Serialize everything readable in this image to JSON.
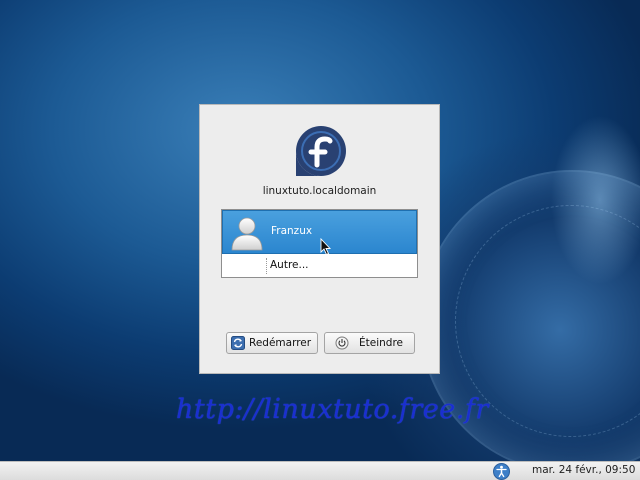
{
  "dialog": {
    "hostname": "linuxtuto.localdomain",
    "users": [
      {
        "name": "Franzux",
        "selected": true
      },
      {
        "name": "Autre...",
        "selected": false
      }
    ],
    "buttons": {
      "restart_label": "Redémarrer",
      "shutdown_label": "Éteindre"
    }
  },
  "watermark": {
    "text": "http://linuxtuto.free.fr"
  },
  "panel": {
    "clock": "mar. 24 févr., 09:50",
    "accessibility_icon": "accessibility-icon"
  },
  "colors": {
    "selection": "#2b86cf",
    "watermark": "#1a2fd0",
    "fedora_blue": "#294172"
  }
}
